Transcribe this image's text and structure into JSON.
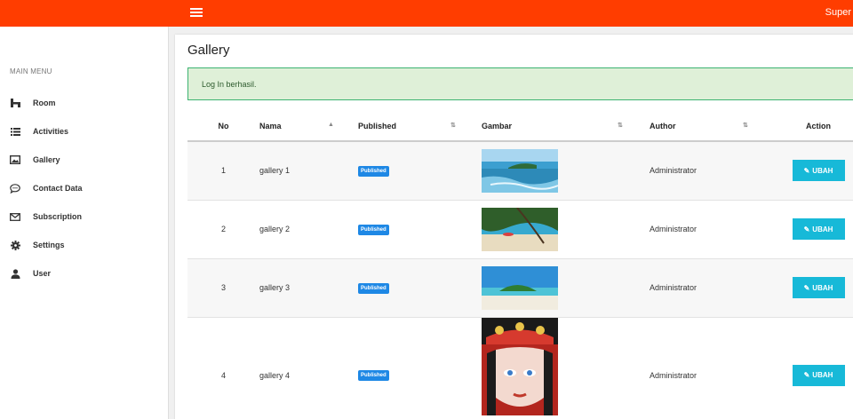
{
  "header": {
    "user": "Super",
    "menu_icon": "hamburger-icon",
    "bg": "#ff3d00"
  },
  "sidebar": {
    "title": "MAIN MENU",
    "items": [
      {
        "label": "Room",
        "icon": "home-icon"
      },
      {
        "label": "Activities",
        "icon": "list-icon"
      },
      {
        "label": "Gallery",
        "icon": "image-icon"
      },
      {
        "label": "Contact Data",
        "icon": "chat-icon"
      },
      {
        "label": "Subscription",
        "icon": "mail-icon"
      },
      {
        "label": "Settings",
        "icon": "gear-icon"
      },
      {
        "label": "User",
        "icon": "person-icon"
      }
    ]
  },
  "page": {
    "title": "Gallery",
    "alert": "Log In berhasil."
  },
  "table": {
    "headers": [
      "No",
      "Nama",
      "Published",
      "Gambar",
      "Author",
      "Action"
    ],
    "rows": [
      {
        "no": "1",
        "nama": "gallery 1",
        "status": "Published",
        "author": "Administrator",
        "action": "UBAH"
      },
      {
        "no": "2",
        "nama": "gallery 2",
        "status": "Published",
        "author": "Administrator",
        "action": "UBAH"
      },
      {
        "no": "3",
        "nama": "gallery 3",
        "status": "Published",
        "author": "Administrator",
        "action": "UBAH"
      },
      {
        "no": "4",
        "nama": "gallery 4",
        "status": "Published",
        "author": "Administrator",
        "action": "UBAH"
      }
    ]
  },
  "colors": {
    "accent": "#ff3d00",
    "badge": "#1e88e5",
    "button": "#17b9d8",
    "alert_bg": "#dff0d8"
  }
}
